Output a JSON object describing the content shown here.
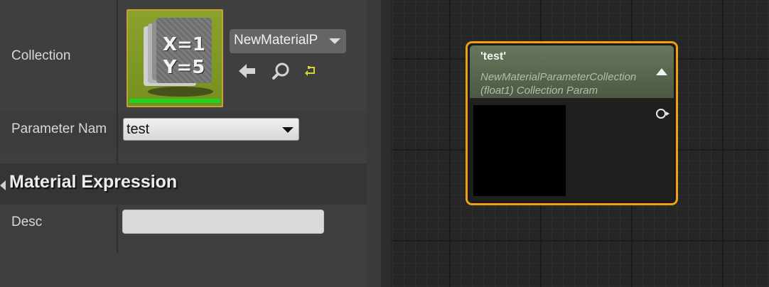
{
  "details": {
    "collection_label": "Collection",
    "collection_asset": "NewMaterialP",
    "thumbnail_formula_line1": "X=1",
    "thumbnail_formula_line2": "Y=5",
    "parameter_name_label": "Parameter Nam",
    "parameter_name_value": "test",
    "category_title": "Material Expression",
    "desc_label": "Desc",
    "desc_value": "",
    "buttons": {
      "use_selected_icon": "arrow-left-icon",
      "browse_icon": "search-icon",
      "reset_icon": "reset-arrow-icon"
    }
  },
  "graph": {
    "node": {
      "title": "'test'",
      "subtitle_line1": "NewMaterialParameterCollection",
      "subtitle_line2": "(float1) Collection Param",
      "preview_color": "#000000",
      "border_color": "#f0a010",
      "header_color": "#5d6b52"
    }
  }
}
